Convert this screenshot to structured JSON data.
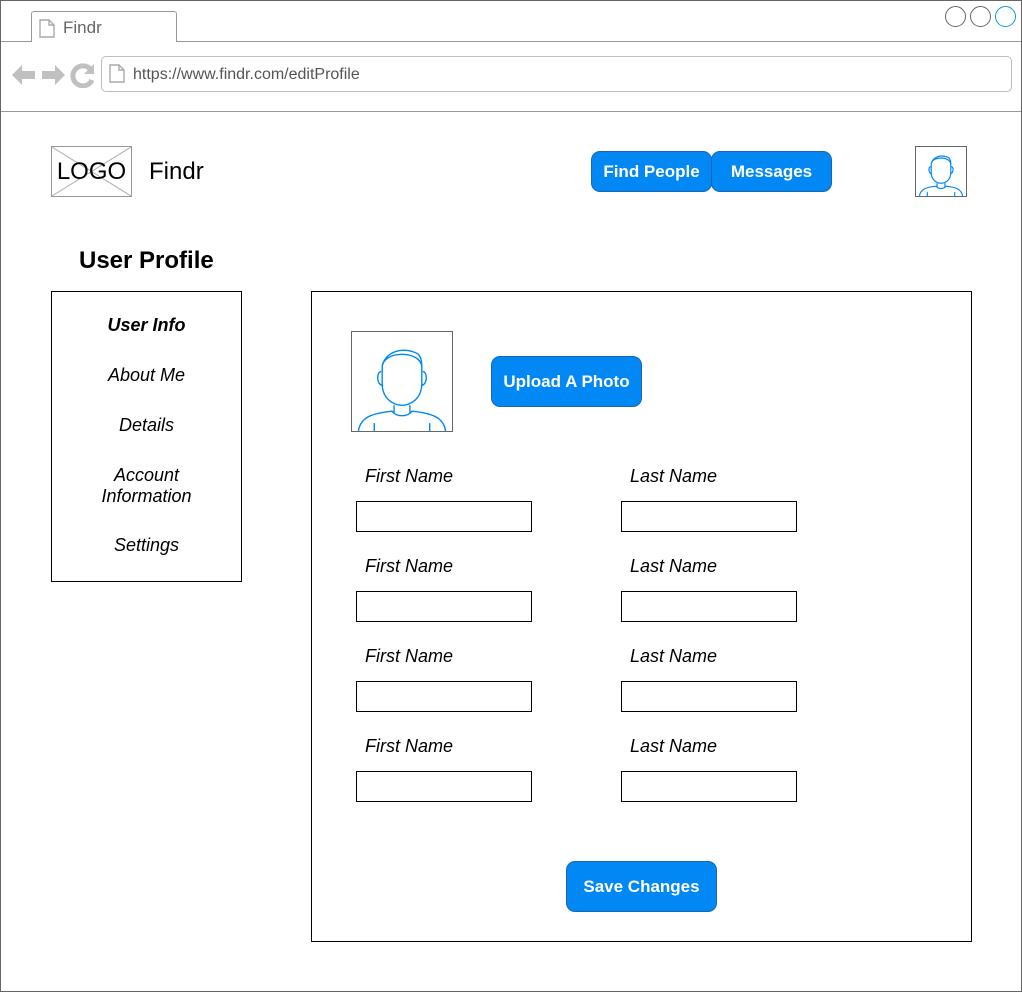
{
  "browser": {
    "tab_title": "Findr",
    "url": "https://www.findr.com/editProfile",
    "icons": [
      "page-icon",
      "back-arrow-icon",
      "forward-arrow-icon",
      "reload-icon",
      "window-control-icons"
    ]
  },
  "header": {
    "logo_label": "LOGO",
    "brand_name": "Findr",
    "nav": {
      "find_people": "Find People",
      "messages": "Messages"
    }
  },
  "page": {
    "title": "User Profile"
  },
  "sidebar": {
    "items": [
      {
        "label": "User Info",
        "active": true
      },
      {
        "label": "About Me",
        "active": false
      },
      {
        "label": "Details",
        "active": false
      },
      {
        "label": "Account Information",
        "active": false
      },
      {
        "label": "Settings",
        "active": false
      }
    ]
  },
  "profile": {
    "upload_label": "Upload A Photo",
    "save_label": "Save Changes",
    "rows": [
      {
        "left_label": "First Name",
        "left_value": "",
        "right_label": "Last Name",
        "right_value": ""
      },
      {
        "left_label": "First Name",
        "left_value": "",
        "right_label": "Last Name",
        "right_value": ""
      },
      {
        "left_label": "First Name",
        "left_value": "",
        "right_label": "Last Name",
        "right_value": ""
      },
      {
        "left_label": "First Name",
        "left_value": "",
        "right_label": "Last Name",
        "right_value": ""
      }
    ]
  },
  "colors": {
    "accent": "#0288f4",
    "accent_border": "#1b66b0",
    "avatar_stroke": "#0288f4",
    "chrome_gray": "#999999"
  }
}
